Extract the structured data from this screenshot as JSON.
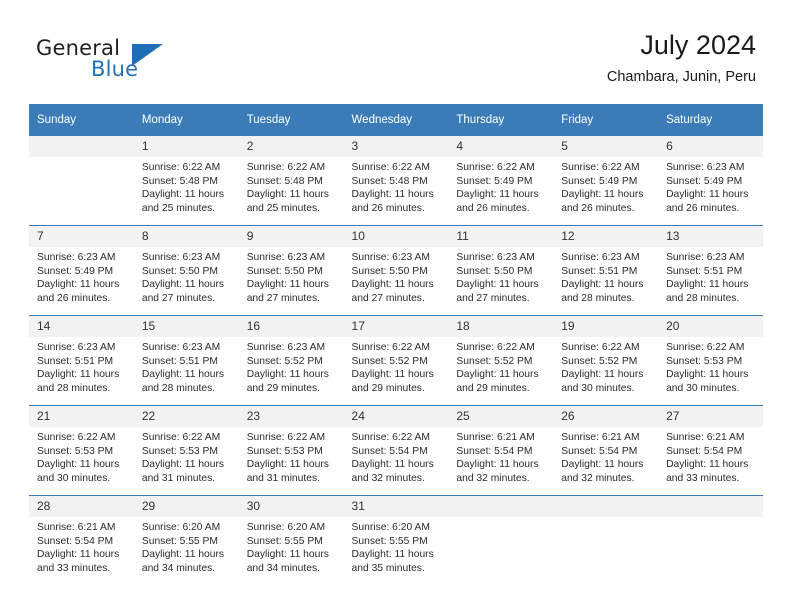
{
  "logo": {
    "word1": "General",
    "word2": "Blue",
    "accent_color": "#2272b8"
  },
  "header": {
    "title": "July 2024",
    "subtitle": "Chambara, Junin, Peru",
    "header_bg": "#3b7cb8",
    "daynum_bg": "#f2f2f2"
  },
  "weekday_headers": [
    "Sunday",
    "Monday",
    "Tuesday",
    "Wednesday",
    "Thursday",
    "Friday",
    "Saturday"
  ],
  "labels": {
    "sunrise_prefix": "Sunrise:",
    "sunset_prefix": "Sunset:",
    "daylight_prefix": "Daylight:"
  },
  "weeks": [
    [
      {
        "day": "",
        "sunrise": "",
        "sunset": "",
        "daylight_line1": "",
        "daylight_line2": ""
      },
      {
        "day": "1",
        "sunrise": "Sunrise: 6:22 AM",
        "sunset": "Sunset: 5:48 PM",
        "daylight_line1": "Daylight: 11 hours",
        "daylight_line2": "and 25 minutes."
      },
      {
        "day": "2",
        "sunrise": "Sunrise: 6:22 AM",
        "sunset": "Sunset: 5:48 PM",
        "daylight_line1": "Daylight: 11 hours",
        "daylight_line2": "and 25 minutes."
      },
      {
        "day": "3",
        "sunrise": "Sunrise: 6:22 AM",
        "sunset": "Sunset: 5:48 PM",
        "daylight_line1": "Daylight: 11 hours",
        "daylight_line2": "and 26 minutes."
      },
      {
        "day": "4",
        "sunrise": "Sunrise: 6:22 AM",
        "sunset": "Sunset: 5:49 PM",
        "daylight_line1": "Daylight: 11 hours",
        "daylight_line2": "and 26 minutes."
      },
      {
        "day": "5",
        "sunrise": "Sunrise: 6:22 AM",
        "sunset": "Sunset: 5:49 PM",
        "daylight_line1": "Daylight: 11 hours",
        "daylight_line2": "and 26 minutes."
      },
      {
        "day": "6",
        "sunrise": "Sunrise: 6:23 AM",
        "sunset": "Sunset: 5:49 PM",
        "daylight_line1": "Daylight: 11 hours",
        "daylight_line2": "and 26 minutes."
      }
    ],
    [
      {
        "day": "7",
        "sunrise": "Sunrise: 6:23 AM",
        "sunset": "Sunset: 5:49 PM",
        "daylight_line1": "Daylight: 11 hours",
        "daylight_line2": "and 26 minutes."
      },
      {
        "day": "8",
        "sunrise": "Sunrise: 6:23 AM",
        "sunset": "Sunset: 5:50 PM",
        "daylight_line1": "Daylight: 11 hours",
        "daylight_line2": "and 27 minutes."
      },
      {
        "day": "9",
        "sunrise": "Sunrise: 6:23 AM",
        "sunset": "Sunset: 5:50 PM",
        "daylight_line1": "Daylight: 11 hours",
        "daylight_line2": "and 27 minutes."
      },
      {
        "day": "10",
        "sunrise": "Sunrise: 6:23 AM",
        "sunset": "Sunset: 5:50 PM",
        "daylight_line1": "Daylight: 11 hours",
        "daylight_line2": "and 27 minutes."
      },
      {
        "day": "11",
        "sunrise": "Sunrise: 6:23 AM",
        "sunset": "Sunset: 5:50 PM",
        "daylight_line1": "Daylight: 11 hours",
        "daylight_line2": "and 27 minutes."
      },
      {
        "day": "12",
        "sunrise": "Sunrise: 6:23 AM",
        "sunset": "Sunset: 5:51 PM",
        "daylight_line1": "Daylight: 11 hours",
        "daylight_line2": "and 28 minutes."
      },
      {
        "day": "13",
        "sunrise": "Sunrise: 6:23 AM",
        "sunset": "Sunset: 5:51 PM",
        "daylight_line1": "Daylight: 11 hours",
        "daylight_line2": "and 28 minutes."
      }
    ],
    [
      {
        "day": "14",
        "sunrise": "Sunrise: 6:23 AM",
        "sunset": "Sunset: 5:51 PM",
        "daylight_line1": "Daylight: 11 hours",
        "daylight_line2": "and 28 minutes."
      },
      {
        "day": "15",
        "sunrise": "Sunrise: 6:23 AM",
        "sunset": "Sunset: 5:51 PM",
        "daylight_line1": "Daylight: 11 hours",
        "daylight_line2": "and 28 minutes."
      },
      {
        "day": "16",
        "sunrise": "Sunrise: 6:23 AM",
        "sunset": "Sunset: 5:52 PM",
        "daylight_line1": "Daylight: 11 hours",
        "daylight_line2": "and 29 minutes."
      },
      {
        "day": "17",
        "sunrise": "Sunrise: 6:22 AM",
        "sunset": "Sunset: 5:52 PM",
        "daylight_line1": "Daylight: 11 hours",
        "daylight_line2": "and 29 minutes."
      },
      {
        "day": "18",
        "sunrise": "Sunrise: 6:22 AM",
        "sunset": "Sunset: 5:52 PM",
        "daylight_line1": "Daylight: 11 hours",
        "daylight_line2": "and 29 minutes."
      },
      {
        "day": "19",
        "sunrise": "Sunrise: 6:22 AM",
        "sunset": "Sunset: 5:52 PM",
        "daylight_line1": "Daylight: 11 hours",
        "daylight_line2": "and 30 minutes."
      },
      {
        "day": "20",
        "sunrise": "Sunrise: 6:22 AM",
        "sunset": "Sunset: 5:53 PM",
        "daylight_line1": "Daylight: 11 hours",
        "daylight_line2": "and 30 minutes."
      }
    ],
    [
      {
        "day": "21",
        "sunrise": "Sunrise: 6:22 AM",
        "sunset": "Sunset: 5:53 PM",
        "daylight_line1": "Daylight: 11 hours",
        "daylight_line2": "and 30 minutes."
      },
      {
        "day": "22",
        "sunrise": "Sunrise: 6:22 AM",
        "sunset": "Sunset: 5:53 PM",
        "daylight_line1": "Daylight: 11 hours",
        "daylight_line2": "and 31 minutes."
      },
      {
        "day": "23",
        "sunrise": "Sunrise: 6:22 AM",
        "sunset": "Sunset: 5:53 PM",
        "daylight_line1": "Daylight: 11 hours",
        "daylight_line2": "and 31 minutes."
      },
      {
        "day": "24",
        "sunrise": "Sunrise: 6:22 AM",
        "sunset": "Sunset: 5:54 PM",
        "daylight_line1": "Daylight: 11 hours",
        "daylight_line2": "and 32 minutes."
      },
      {
        "day": "25",
        "sunrise": "Sunrise: 6:21 AM",
        "sunset": "Sunset: 5:54 PM",
        "daylight_line1": "Daylight: 11 hours",
        "daylight_line2": "and 32 minutes."
      },
      {
        "day": "26",
        "sunrise": "Sunrise: 6:21 AM",
        "sunset": "Sunset: 5:54 PM",
        "daylight_line1": "Daylight: 11 hours",
        "daylight_line2": "and 32 minutes."
      },
      {
        "day": "27",
        "sunrise": "Sunrise: 6:21 AM",
        "sunset": "Sunset: 5:54 PM",
        "daylight_line1": "Daylight: 11 hours",
        "daylight_line2": "and 33 minutes."
      }
    ],
    [
      {
        "day": "28",
        "sunrise": "Sunrise: 6:21 AM",
        "sunset": "Sunset: 5:54 PM",
        "daylight_line1": "Daylight: 11 hours",
        "daylight_line2": "and 33 minutes."
      },
      {
        "day": "29",
        "sunrise": "Sunrise: 6:20 AM",
        "sunset": "Sunset: 5:55 PM",
        "daylight_line1": "Daylight: 11 hours",
        "daylight_line2": "and 34 minutes."
      },
      {
        "day": "30",
        "sunrise": "Sunrise: 6:20 AM",
        "sunset": "Sunset: 5:55 PM",
        "daylight_line1": "Daylight: 11 hours",
        "daylight_line2": "and 34 minutes."
      },
      {
        "day": "31",
        "sunrise": "Sunrise: 6:20 AM",
        "sunset": "Sunset: 5:55 PM",
        "daylight_line1": "Daylight: 11 hours",
        "daylight_line2": "and 35 minutes."
      },
      {
        "day": "",
        "sunrise": "",
        "sunset": "",
        "daylight_line1": "",
        "daylight_line2": ""
      },
      {
        "day": "",
        "sunrise": "",
        "sunset": "",
        "daylight_line1": "",
        "daylight_line2": ""
      },
      {
        "day": "",
        "sunrise": "",
        "sunset": "",
        "daylight_line1": "",
        "daylight_line2": ""
      }
    ]
  ]
}
